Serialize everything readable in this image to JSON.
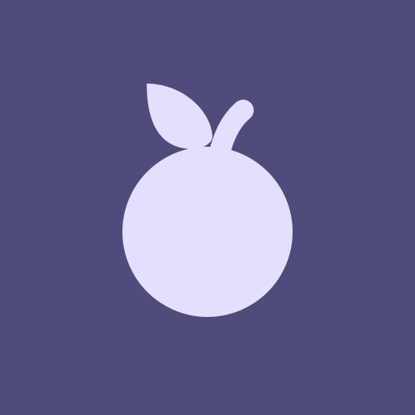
{
  "icon": {
    "name": "fruit-icon",
    "background_color": "#4f4c7c",
    "foreground_color": "#e3dffc"
  }
}
